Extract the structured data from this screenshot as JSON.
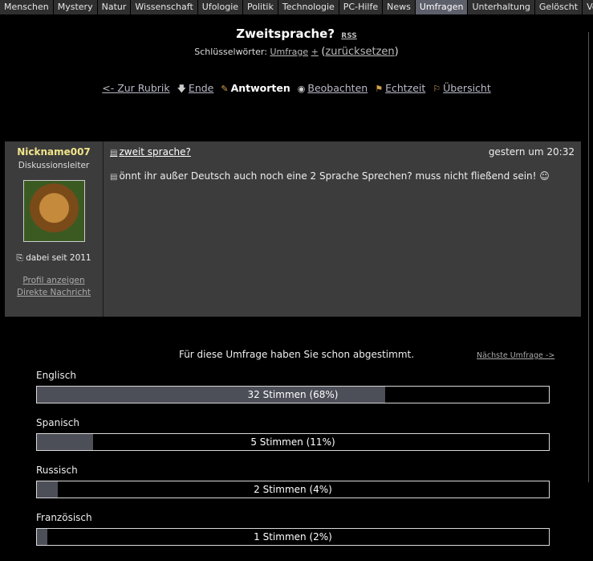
{
  "tabs": [
    "Menschen",
    "Mystery",
    "Natur",
    "Wissenschaft",
    "Ufologie",
    "Politik",
    "Technologie",
    "PC-Hilfe",
    "News",
    "Umfragen",
    "Unterhaltung",
    "Gelöscht",
    "Verbessert"
  ],
  "active_tab": "Umfragen",
  "thread": {
    "title": "Zweitsprache?",
    "rss": "RSS",
    "keywords_label": "Schlüsselwörter:",
    "keyword": "Umfrage",
    "plus": "+",
    "reset_open": "(",
    "reset": "zurücksetzen",
    "reset_close": ")"
  },
  "nav": {
    "back": "<- Zur Rubrik",
    "end": "Ende",
    "answers": "Antworten",
    "watch": "Beobachten",
    "realtime": "Echtzeit",
    "overview": "Übersicht"
  },
  "post": {
    "username": "Nickname007",
    "role": "Diskussionsleiter",
    "since": "dabei seit 2011",
    "profile_link": "Profil anzeigen",
    "message_link": "Direkte Nachricht",
    "title": "zweit sprache?",
    "date": "gestern um 20:32",
    "text": "önnt ihr außer Deutsch auch noch eine 2 Sprache Sprechen? muss nicht fließend sein! ☺"
  },
  "poll": {
    "voted_text": "Für diese Umfrage haben Sie schon abgestimmt.",
    "next_poll": "Nächste Umfrage ->",
    "options": [
      {
        "label": "Englisch",
        "text": "32 Stimmen (68%)",
        "fraction": 0.68
      },
      {
        "label": "Spanisch",
        "text": "5 Stimmen (11%)",
        "fraction": 0.11
      },
      {
        "label": "Russisch",
        "text": "2 Stimmen (4%)",
        "fraction": 0.04
      },
      {
        "label": "Französisch",
        "text": "1 Stimmen (2%)",
        "fraction": 0.02
      }
    ]
  }
}
